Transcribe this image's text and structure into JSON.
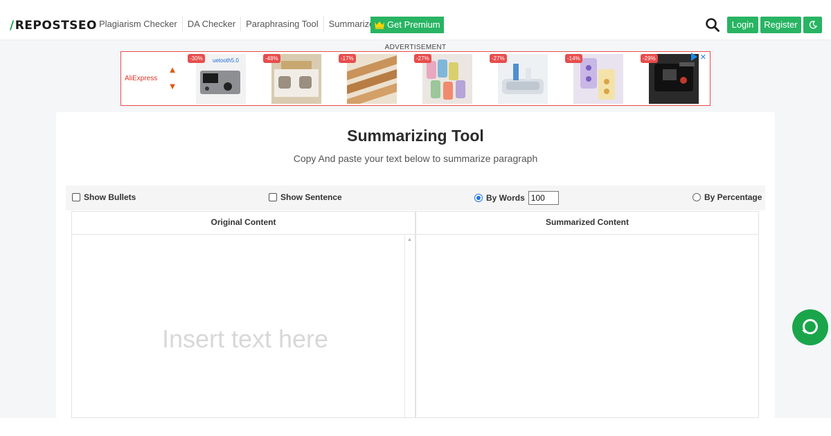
{
  "header": {
    "logo_mark": "/",
    "logo_text": "REPOSTSEO",
    "nav": [
      "Plagiarism Checker",
      "DA Checker",
      "Paraphrasing Tool",
      "Summarizer"
    ],
    "premium_label": "Get Premium",
    "search_icon": "search-icon",
    "login_label": "Login",
    "register_label": "Register",
    "theme_icon": "moon-icon"
  },
  "ad": {
    "label": "ADVERTISEMENT",
    "brand": "AliExpress",
    "discounts": [
      "-30%",
      "-48%",
      "-17%",
      "-27%",
      "-27%",
      "-14%",
      "-29%"
    ],
    "close": "✕"
  },
  "tool": {
    "title": "Summarizing Tool",
    "subtitle": "Copy And paste your text below to summarize paragraph",
    "show_bullets": "Show Bullets",
    "show_sentence": "Show Sentence",
    "by_words": "By Words",
    "words_value": "100",
    "by_percentage": "By Percentage",
    "original_header": "Original Content",
    "summarized_header": "Summarized Content",
    "placeholder": "Insert text here"
  },
  "colors": {
    "accent": "#28b463",
    "ad_border": "#e84c4c",
    "radio": "#1a73e8"
  }
}
